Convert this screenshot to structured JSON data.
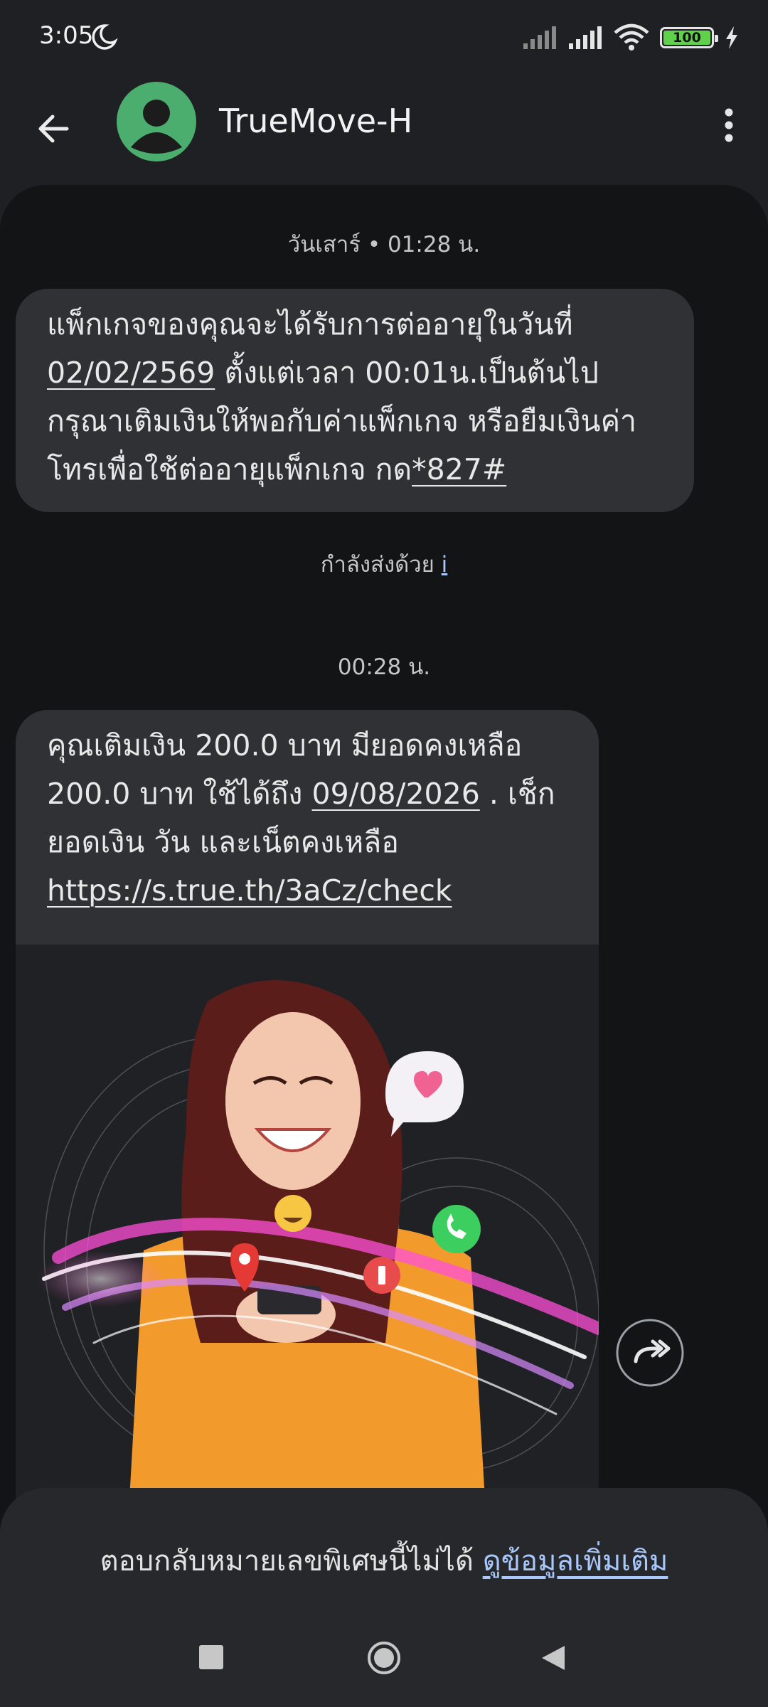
{
  "status_bar": {
    "time": "3:05",
    "battery": "100"
  },
  "header": {
    "contact_name": "TrueMove-H"
  },
  "messages": [
    {
      "timestamp": "วันเสาร์ • 01:28 น.",
      "text_1": "แพ็กเกจของคุณจะได้รับการต่ออายุในวันที่",
      "date_link": "02/02/2569",
      "text_2": " ตั้งแต่เวลา 00:01น.เป็นต้นไป",
      "text_3": "กรุณาเติมเงินให้พอกับค่าแพ็กเกจ หรือยืมเงินค่า",
      "text_4": "โทรเพื่อใช้ต่ออายุแพ็กเกจ กด",
      "ussd_link": "*827#",
      "sent_via": "กำลังส่งด้วย",
      "sent_via_icon": "i"
    },
    {
      "timestamp": "00:28 น.",
      "text_1": "คุณเติมเงิน 200.0 บาท มียอดคงเหลือ",
      "text_2": "200.0 บาท ใช้ได้ถึง ",
      "date_link": "09/08/2026",
      "text_3": " . เช็ก",
      "text_4": "ยอดเงิน วัน และเน็ตคงเหลือ",
      "url": "https://s.true.th/3aCz/check"
    }
  ],
  "footer": {
    "note": "ตอบกลับหมายเลขพิเศษนี้ไม่ได้ ",
    "learn_more": "ดูข้อมูลเพิ่มเติม"
  },
  "colors": {
    "background": "#131416",
    "bubble": "#303134",
    "avatar": "#4cae6e",
    "link": "#a8c7fa",
    "battery": "#5fd14a"
  },
  "icons": [
    "moon-icon",
    "signal-icon",
    "wifi-icon",
    "battery-icon",
    "charging-icon",
    "back-arrow-icon",
    "person-icon",
    "more-vert-icon",
    "forward-icon",
    "recents-icon",
    "home-icon",
    "nav-back-icon"
  ]
}
